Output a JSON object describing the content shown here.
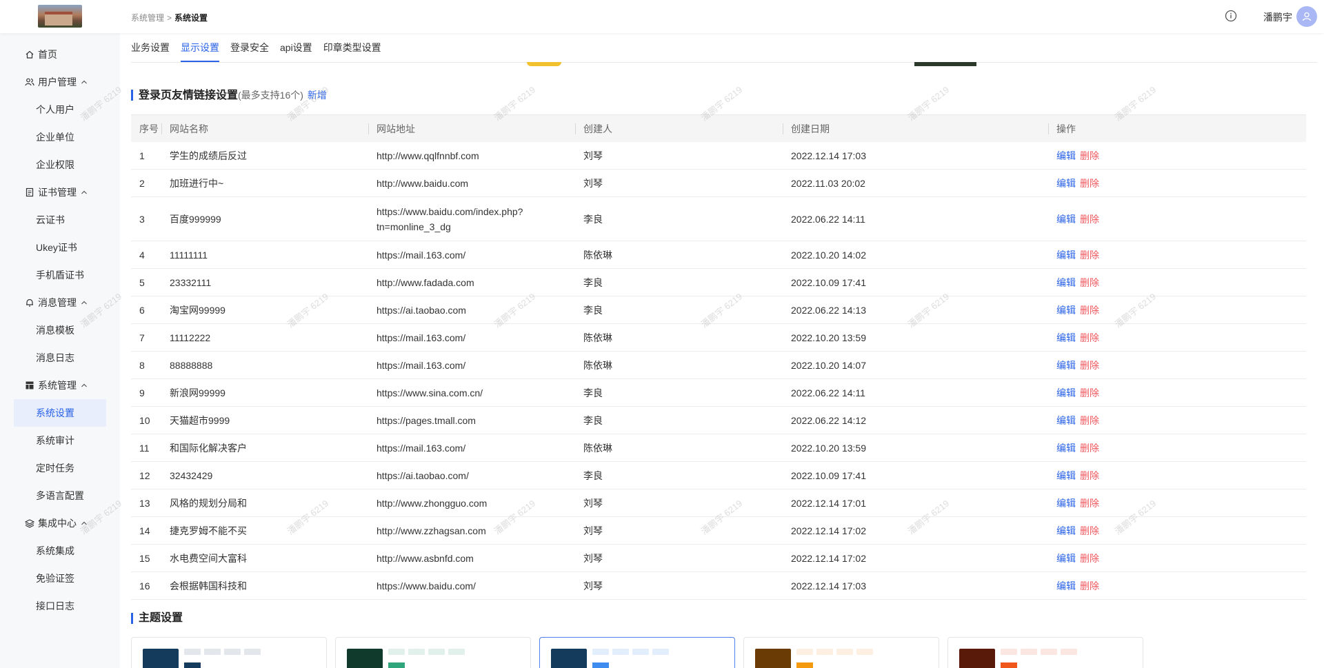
{
  "header": {
    "breadcrumb_parent": "系统管理",
    "breadcrumb_sep": ">",
    "breadcrumb_current": "系统设置",
    "username": "潘鹏宇"
  },
  "sidebar": {
    "items": [
      {
        "label": "首页",
        "icon": "home-icon",
        "type": "parent"
      },
      {
        "label": "用户管理",
        "icon": "users-icon",
        "type": "parent",
        "expanded": true
      },
      {
        "label": "个人用户",
        "type": "child"
      },
      {
        "label": "企业单位",
        "type": "child"
      },
      {
        "label": "企业权限",
        "type": "child"
      },
      {
        "label": "证书管理",
        "icon": "certificate-icon",
        "type": "parent",
        "expanded": true
      },
      {
        "label": "云证书",
        "type": "child"
      },
      {
        "label": "Ukey证书",
        "type": "child"
      },
      {
        "label": "手机盾证书",
        "type": "child"
      },
      {
        "label": "消息管理",
        "icon": "bell-icon",
        "type": "parent",
        "expanded": true
      },
      {
        "label": "消息模板",
        "type": "child"
      },
      {
        "label": "消息日志",
        "type": "child"
      },
      {
        "label": "系统管理",
        "icon": "layout-icon",
        "type": "parent",
        "expanded": true
      },
      {
        "label": "系统设置",
        "type": "child",
        "active": true
      },
      {
        "label": "系统审计",
        "type": "child"
      },
      {
        "label": "定时任务",
        "type": "child"
      },
      {
        "label": "多语言配置",
        "type": "child"
      },
      {
        "label": "集成中心",
        "icon": "layers-icon",
        "type": "parent",
        "expanded": true
      },
      {
        "label": "系统集成",
        "type": "child"
      },
      {
        "label": "免验证签",
        "type": "child"
      },
      {
        "label": "接口日志",
        "type": "child"
      }
    ]
  },
  "tabs": [
    {
      "label": "业务设置",
      "active": false
    },
    {
      "label": "显示设置",
      "active": true
    },
    {
      "label": "登录安全",
      "active": false
    },
    {
      "label": "api设置",
      "active": false
    },
    {
      "label": "印章类型设置",
      "active": false
    }
  ],
  "links_section": {
    "title": "登录页友情链接设置",
    "note": "(最多支持16个)",
    "add_label": "新增"
  },
  "table": {
    "columns": [
      "序号",
      "网站名称",
      "网站地址",
      "创建人",
      "创建日期",
      "操作"
    ],
    "edit_label": "编辑",
    "delete_label": "删除",
    "rows": [
      {
        "no": "1",
        "name": "学生的成绩后反过",
        "url": "http://www.qqlfnnbf.com",
        "creator": "刘琴",
        "date": "2022.12.14 17:03"
      },
      {
        "no": "2",
        "name": "加班进行中~",
        "url": "http://www.baidu.com",
        "creator": "刘琴",
        "date": "2022.11.03 20:02"
      },
      {
        "no": "3",
        "name": "百度999999",
        "url": "https://www.baidu.com/index.php?",
        "url2": "tn=monline_3_dg",
        "creator": "李良",
        "date": "2022.06.22 14:11"
      },
      {
        "no": "4",
        "name": "11111111",
        "url": "https://mail.163.com/",
        "creator": "陈依琳",
        "date": "2022.10.20 14:02"
      },
      {
        "no": "5",
        "name": "23332111",
        "url": "http://www.fadada.com",
        "creator": "李良",
        "date": "2022.10.09 17:41"
      },
      {
        "no": "6",
        "name": "淘宝网99999",
        "url": "https://ai.taobao.com",
        "creator": "李良",
        "date": "2022.06.22 14:13"
      },
      {
        "no": "7",
        "name": "11112222",
        "url": "https://mail.163.com/",
        "creator": "陈依琳",
        "date": "2022.10.20 13:59"
      },
      {
        "no": "8",
        "name": "88888888",
        "url": "https://mail.163.com/",
        "creator": "陈依琳",
        "date": "2022.10.20 14:07"
      },
      {
        "no": "9",
        "name": "新浪网99999",
        "url": "https://www.sina.com.cn/",
        "creator": "李良",
        "date": "2022.06.22 14:11"
      },
      {
        "no": "10",
        "name": "天猫超市9999",
        "url": "https://pages.tmall.com",
        "creator": "李良",
        "date": "2022.06.22 14:12"
      },
      {
        "no": "11",
        "name": "和国际化解决客户",
        "url": "https://mail.163.com/",
        "creator": "陈依琳",
        "date": "2022.10.20 13:59"
      },
      {
        "no": "12",
        "name": "32432429",
        "url": "https://ai.taobao.com/",
        "creator": "李良",
        "date": "2022.10.09 17:41"
      },
      {
        "no": "13",
        "name": "风格的规划分局和",
        "url": "http://www.zhongguo.com",
        "creator": "刘琴",
        "date": "2022.12.14 17:01"
      },
      {
        "no": "14",
        "name": "捷克罗姆不能不买",
        "url": "http://www.zzhagsan.com",
        "creator": "刘琴",
        "date": "2022.12.14 17:02"
      },
      {
        "no": "15",
        "name": "水电费空间大富科",
        "url": "http://www.asbnfd.com",
        "creator": "刘琴",
        "date": "2022.12.14 17:02"
      },
      {
        "no": "16",
        "name": "会根据韩国科技和",
        "url": "https://www.baidu.com/",
        "creator": "刘琴",
        "date": "2022.12.14 17:03"
      }
    ]
  },
  "theme_section": {
    "title": "主题设置",
    "themes": [
      {
        "primary": "#143a5c",
        "accent": "#143a5c",
        "light": "#e3e6ea",
        "selected": false
      },
      {
        "primary": "#0f3a2c",
        "accent": "#2ea57a",
        "light": "#e1f0ea",
        "selected": false
      },
      {
        "primary": "#143a5c",
        "accent": "#3f8cf0",
        "light": "#e3eefc",
        "selected": true
      },
      {
        "primary": "#6b3b06",
        "accent": "#f59a0f",
        "light": "#fdf0e2",
        "selected": false
      },
      {
        "primary": "#5a1a0a",
        "accent": "#f0571a",
        "light": "#fce6e2",
        "selected": false
      }
    ]
  },
  "watermark_text": "潘鹏宇 6219",
  "colors": {
    "primary": "#2a62e8",
    "danger": "#f0585e",
    "sidebar_bg": "#f7f8fa",
    "active_bg": "#e8eefc"
  }
}
